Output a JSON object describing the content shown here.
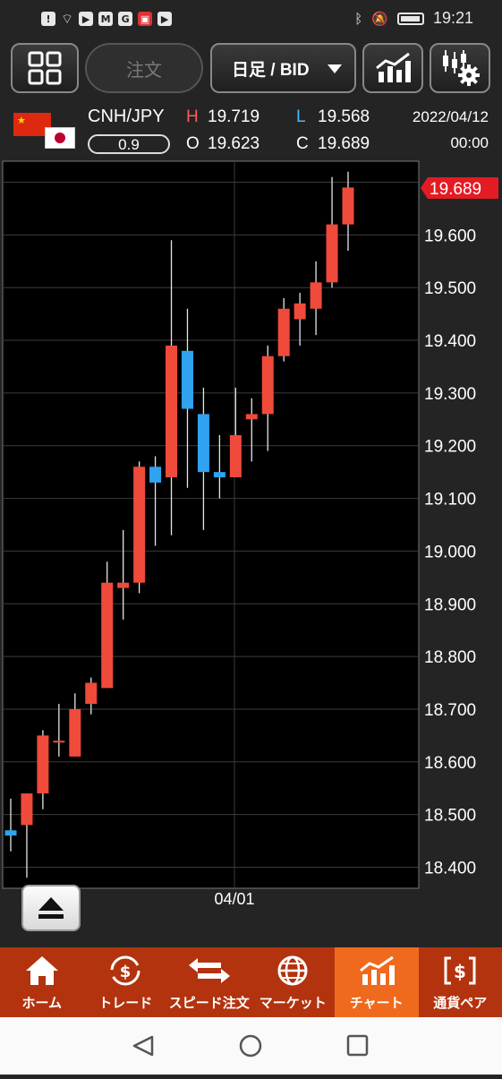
{
  "status_bar": {
    "time": "19:21",
    "left_icons": [
      "alert-icon",
      "wifi-icon",
      "youtube-icon",
      "gmail-icon",
      "google-icon",
      "cube-icon",
      "youtube-icon"
    ],
    "right_icons": [
      "bluetooth-icon",
      "mute-icon",
      "battery-icon"
    ]
  },
  "toolbar": {
    "order_label": "注文",
    "timeframe_label": "日足 / BID"
  },
  "info": {
    "pair": "CNH/JPY",
    "spread": "0.9",
    "high_key": "H",
    "high": "19.719",
    "low_key": "L",
    "low": "19.568",
    "open_key": "O",
    "open": "19.623",
    "close_key": "C",
    "close": "19.689",
    "date": "2022/04/12",
    "time": "00:00"
  },
  "colors": {
    "up": "#f04a3a",
    "down": "#2fa3f0",
    "grid": "#3c3c3c",
    "price_tag": "#e31b23",
    "nav_bg": "#b3330f",
    "nav_active": "#f06a1d"
  },
  "chart_data": {
    "type": "candlestick",
    "x_label_tick": "04/01",
    "y_ticks": [
      "19.600",
      "19.500",
      "19.400",
      "19.300",
      "19.200",
      "19.100",
      "19.000",
      "18.900",
      "18.800",
      "18.700",
      "18.600",
      "18.500",
      "18.400"
    ],
    "current_price": "19.689",
    "ylim": [
      18.36,
      19.74
    ],
    "candles": [
      {
        "o": 18.47,
        "h": 18.53,
        "l": 18.43,
        "c": 18.46
      },
      {
        "o": 18.48,
        "h": 18.54,
        "l": 18.38,
        "c": 18.54
      },
      {
        "o": 18.54,
        "h": 18.66,
        "l": 18.51,
        "c": 18.65
      },
      {
        "o": 18.64,
        "h": 18.71,
        "l": 18.61,
        "c": 18.64
      },
      {
        "o": 18.61,
        "h": 18.73,
        "l": 18.61,
        "c": 18.7
      },
      {
        "o": 18.71,
        "h": 18.76,
        "l": 18.69,
        "c": 18.75
      },
      {
        "o": 18.74,
        "h": 18.98,
        "l": 18.74,
        "c": 18.94
      },
      {
        "o": 18.93,
        "h": 19.04,
        "l": 18.87,
        "c": 18.94
      },
      {
        "o": 18.94,
        "h": 19.17,
        "l": 18.92,
        "c": 19.16
      },
      {
        "o": 19.16,
        "h": 19.18,
        "l": 19.01,
        "c": 19.13
      },
      {
        "o": 19.14,
        "h": 19.59,
        "l": 19.03,
        "c": 19.39
      },
      {
        "o": 19.38,
        "h": 19.46,
        "l": 19.12,
        "c": 19.27
      },
      {
        "o": 19.26,
        "h": 19.31,
        "l": 19.04,
        "c": 19.15
      },
      {
        "o": 19.15,
        "h": 19.22,
        "l": 19.1,
        "c": 19.14
      },
      {
        "o": 19.14,
        "h": 19.31,
        "l": 19.14,
        "c": 19.22
      },
      {
        "o": 19.25,
        "h": 19.29,
        "l": 19.17,
        "c": 19.26
      },
      {
        "o": 19.26,
        "h": 19.39,
        "l": 19.19,
        "c": 19.37
      },
      {
        "o": 19.37,
        "h": 19.48,
        "l": 19.36,
        "c": 19.46
      },
      {
        "o": 19.44,
        "h": 19.49,
        "l": 19.39,
        "c": 19.47
      },
      {
        "o": 19.46,
        "h": 19.55,
        "l": 19.41,
        "c": 19.51
      },
      {
        "o": 19.51,
        "h": 19.71,
        "l": 19.5,
        "c": 19.62
      },
      {
        "o": 19.62,
        "h": 19.72,
        "l": 19.57,
        "c": 19.69
      }
    ]
  },
  "bottom_nav": [
    {
      "label": "ホーム",
      "icon": "home-icon"
    },
    {
      "label": "トレード",
      "icon": "trade-icon"
    },
    {
      "label": "スピード注文",
      "icon": "speed-order-icon"
    },
    {
      "label": "マーケット",
      "icon": "globe-icon"
    },
    {
      "label": "チャート",
      "icon": "chart-icon",
      "active": true
    },
    {
      "label": "通貨ペア",
      "icon": "currency-pair-icon"
    }
  ]
}
